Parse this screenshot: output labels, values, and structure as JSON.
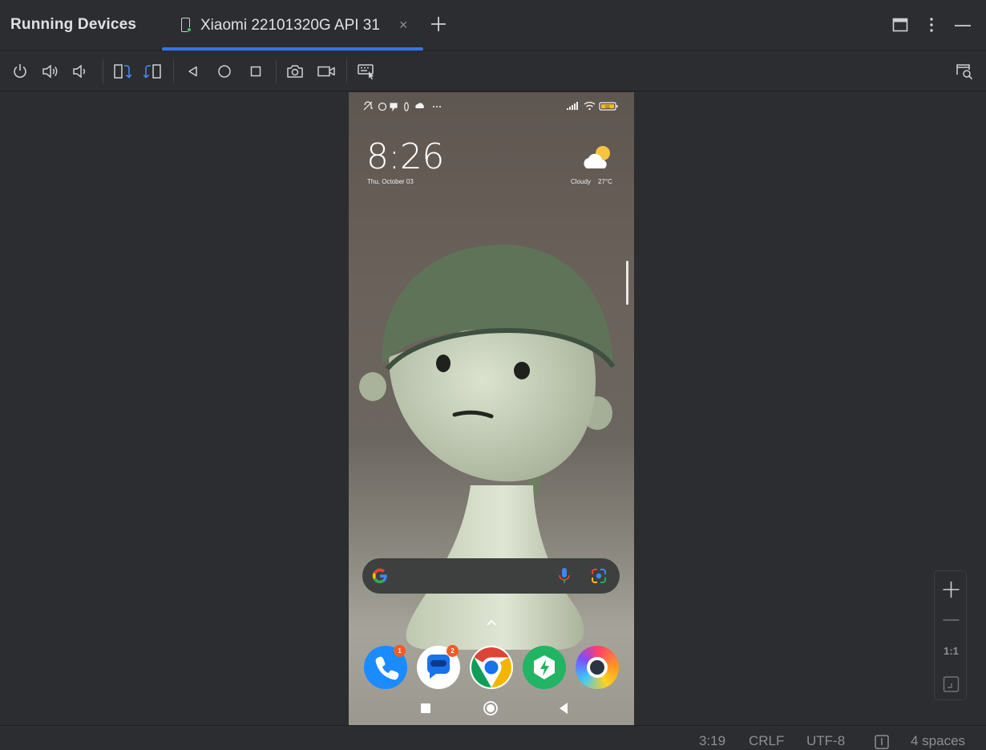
{
  "panel": {
    "title": "Running Devices"
  },
  "tab": {
    "label": "Xiaomi 22101320G API 31",
    "close": "×"
  },
  "toolbar": {
    "buttons": [
      "power",
      "volume-up",
      "volume-down",
      "rotate-left",
      "rotate-right",
      "back",
      "home",
      "overview",
      "screenshot",
      "screen-record",
      "keyboard"
    ]
  },
  "phone": {
    "time": "8:26",
    "date": "Thu, October 03",
    "weather_condition": "Cloudy",
    "weather_temp": "27°C",
    "battery": "91",
    "apps": [
      {
        "name": "Phone",
        "badge": "1"
      },
      {
        "name": "Messages",
        "badge": "2"
      },
      {
        "name": "Chrome",
        "badge": ""
      },
      {
        "name": "Security",
        "badge": ""
      },
      {
        "name": "Browser",
        "badge": ""
      }
    ]
  },
  "zoom": {
    "one_to_one": "1:1"
  },
  "statusline": {
    "position": "3:19",
    "line_ending": "CRLF",
    "encoding": "UTF-8",
    "indent": "4 spaces"
  },
  "colors": {
    "accent": "#3574f0",
    "background": "#2b2d30",
    "connected": "#4ec26c"
  }
}
